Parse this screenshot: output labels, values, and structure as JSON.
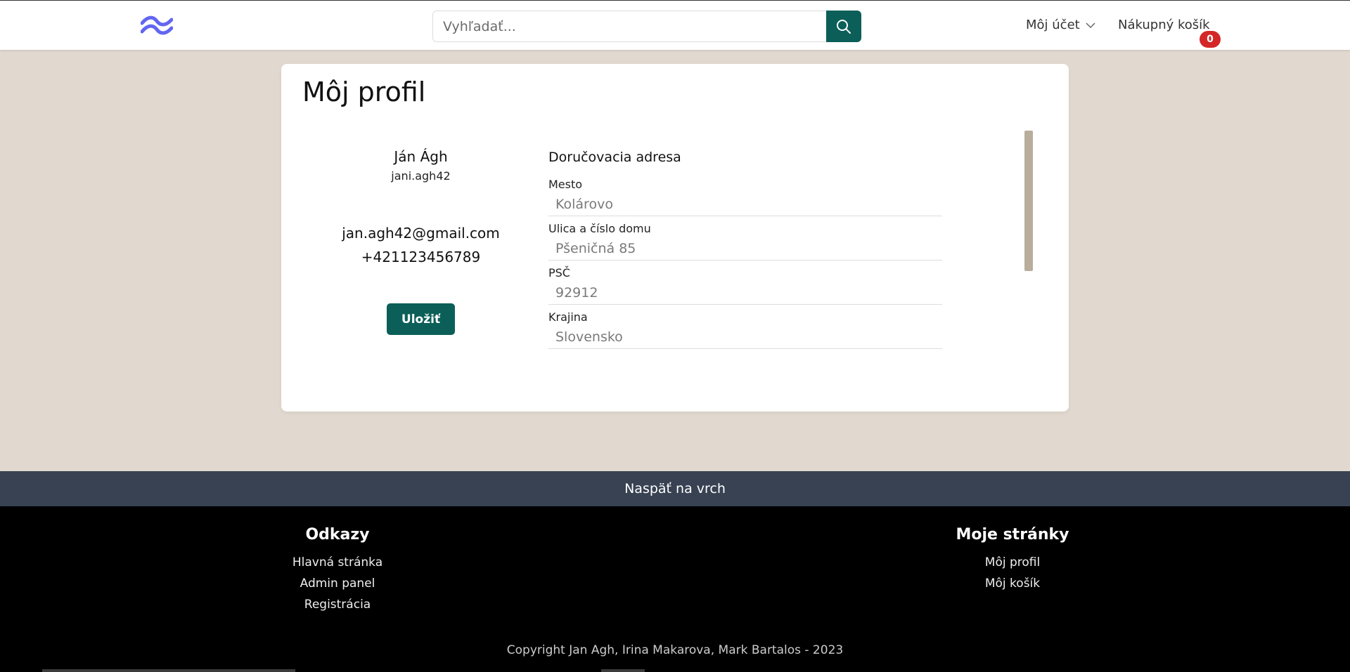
{
  "header": {
    "search": {
      "placeholder": "Vyhľadať..."
    },
    "account_label": "Môj účet",
    "cart_label": "Nákupný košík",
    "cart_count": "0"
  },
  "profile": {
    "title": "Môj profil",
    "name": "Ján Ágh",
    "username": "jani.agh42",
    "email": "jan.agh42@gmail.com",
    "phone": "+421123456789",
    "save_label": "Uložiť"
  },
  "address": {
    "title": "Doručovacia adresa",
    "fields": [
      {
        "label": "Mesto",
        "value": "Kolárovo"
      },
      {
        "label": "Ulica a číslo domu",
        "value": "Pšeničná 85"
      },
      {
        "label": "PSČ",
        "value": "92912"
      },
      {
        "label": "Krajina",
        "value": "Slovensko"
      }
    ]
  },
  "footer": {
    "back_to_top": "Naspäť na vrch",
    "links_heading": "Odkazy",
    "links": [
      "Hlavná stránka",
      "Admin panel",
      "Registrácia"
    ],
    "pages_heading": "Moje stránky",
    "pages": [
      "Môj profil",
      "Môj košík"
    ],
    "copyright": "Copyright Jan Agh, Irina Makarova, Mark Bartalos - 2023"
  },
  "colors": {
    "brand": "#0b5f58",
    "page_bg": "#e1d9cf",
    "badge": "#d42626",
    "back_to_top_bg": "#384253",
    "footer_bg": "#000000",
    "logo": "#6366f1"
  },
  "icons": {
    "logo": "tailwind-wave-logo",
    "search": "search-icon",
    "account": "chevron-down-icon"
  }
}
